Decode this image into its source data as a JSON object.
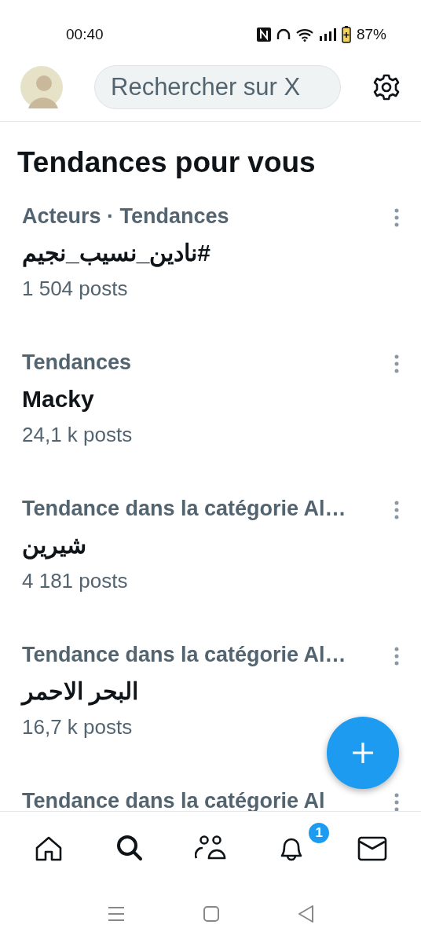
{
  "status_bar": {
    "time": "00:40",
    "battery": "87%"
  },
  "header": {
    "search": {
      "placeholder": "Rechercher sur X"
    }
  },
  "title": "Tendances pour vous",
  "trends": [
    {
      "category": "Acteurs · Tendances",
      "name": "#نادين_نسيب_نجيم",
      "posts": "1 504 posts"
    },
    {
      "category": "Tendances",
      "name": "Macky",
      "posts": "24,1 k posts"
    },
    {
      "category": "Tendance dans la catégorie Al…",
      "name": "شيرين",
      "posts": "4 181 posts"
    },
    {
      "category": "Tendance dans la catégorie Al…",
      "name": "البحر الاحمر",
      "posts": "16,7 k posts"
    },
    {
      "category": "Tendance dans la catégorie Al"
    }
  ],
  "bottom_nav": [
    {
      "kind": "home",
      "selected": false
    },
    {
      "kind": "search",
      "selected": true
    },
    {
      "kind": "communities",
      "selected": false
    },
    {
      "kind": "notifications",
      "selected": false,
      "badge": "1"
    },
    {
      "kind": "messages",
      "selected": false
    }
  ]
}
